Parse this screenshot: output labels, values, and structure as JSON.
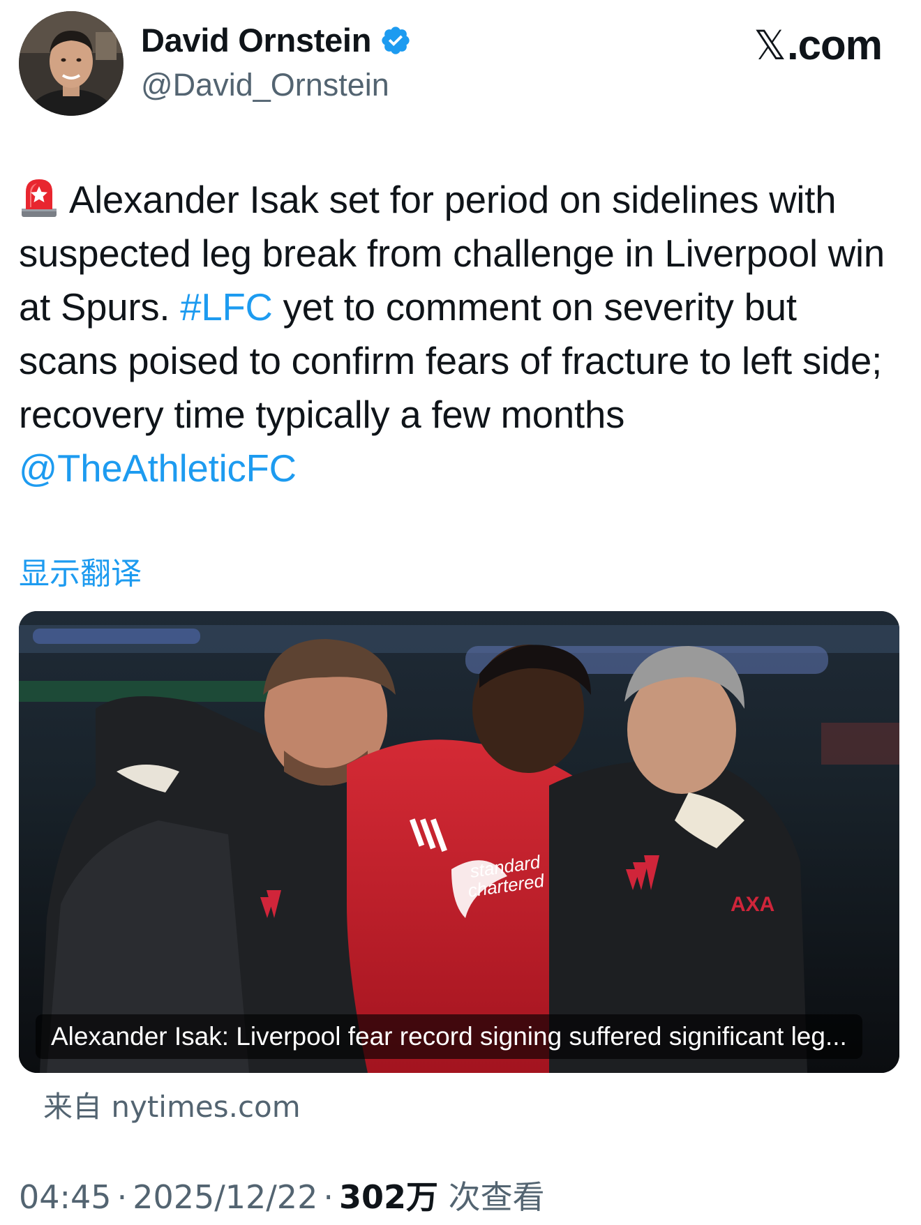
{
  "author": {
    "display_name": "David Ornstein",
    "handle": "@David_Ornstein",
    "verified": true
  },
  "brand": {
    "label": ".com",
    "x_glyph": "𝕏"
  },
  "tweet": {
    "icon": "police-siren-icon",
    "text_part1": "Alexander Isak set for period on sidelines with suspected leg break from challenge in Liverpool win at Spurs. ",
    "hashtag": "#LFC",
    "text_part2": " yet to comment on severity but scans poised to confirm fears of fracture to left side; recovery time typically a few months",
    "mention": "@TheAthleticFC"
  },
  "translate_label": "显示翻译",
  "media": {
    "caption": "Alexander Isak: Liverpool fear record signing suffered significant leg...",
    "source": "来自 nytimes.com"
  },
  "meta": {
    "time": "04:45",
    "separator": "·",
    "date": "2025/12/22",
    "views_count": "302万",
    "views_label": " 次查看"
  },
  "colors": {
    "link": "#1d9bf0",
    "text": "#0f1419",
    "secondary": "#536471",
    "verified": "#1d9bf0",
    "kit_red": "#c8102e"
  }
}
